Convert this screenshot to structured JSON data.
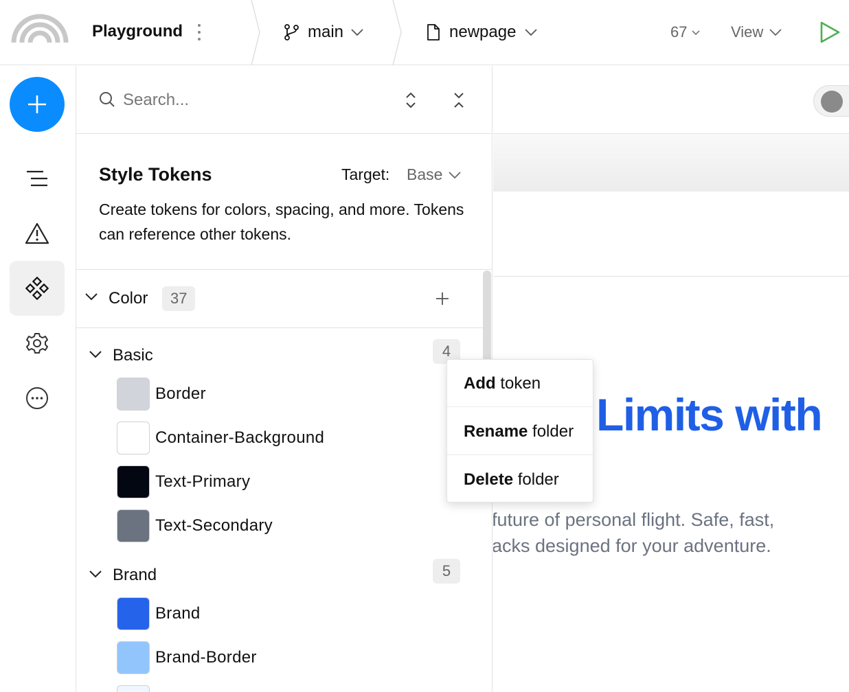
{
  "topbar": {
    "project": "Playground",
    "branch": "main",
    "page": "newpage",
    "zoom": "67",
    "view": "View"
  },
  "search": {
    "placeholder": "Search..."
  },
  "tokens": {
    "title": "Style Tokens",
    "target_label": "Target:",
    "target_value": "Base",
    "description": "Create tokens for colors, spacing, and more. Tokens can reference other tokens."
  },
  "color_section": {
    "label": "Color",
    "count": "37"
  },
  "groups": [
    {
      "label": "Basic",
      "count": "4",
      "tokens": [
        {
          "label": "Border",
          "color": "#d1d5db"
        },
        {
          "label": "Container-Background",
          "color": "#ffffff"
        },
        {
          "label": "Text-Primary",
          "color": "#030712"
        },
        {
          "label": "Text-Secondary",
          "color": "#6b7280"
        }
      ]
    },
    {
      "label": "Brand",
      "count": "5",
      "tokens": [
        {
          "label": "Brand",
          "color": "#2563eb"
        },
        {
          "label": "Brand-Border",
          "color": "#93c5fd"
        },
        {
          "color": "#eff6ff"
        }
      ]
    }
  ],
  "context_menu": {
    "items": [
      {
        "bold": "Add",
        "rest": " token"
      },
      {
        "bold": "Rename",
        "rest": " folder"
      },
      {
        "bold": "Delete",
        "rest": " folder"
      }
    ]
  },
  "canvas": {
    "hero_title": "Limits with",
    "hero_line1": "future of personal flight. Safe, fast,",
    "hero_line2": "acks designed for your adventure.",
    "accent": "#1f5fe6"
  },
  "colors": {
    "primary_button": "#0a8cff",
    "play": "#4caf50"
  },
  "icons": [
    "logo-icon",
    "kebab-icon",
    "branch-icon",
    "file-icon",
    "chevron-down-icon",
    "play-icon",
    "plus-icon",
    "layers-icon",
    "warning-icon",
    "components-icon",
    "gear-icon",
    "more-icon",
    "search-icon",
    "updown-icon",
    "collapse-icon"
  ]
}
